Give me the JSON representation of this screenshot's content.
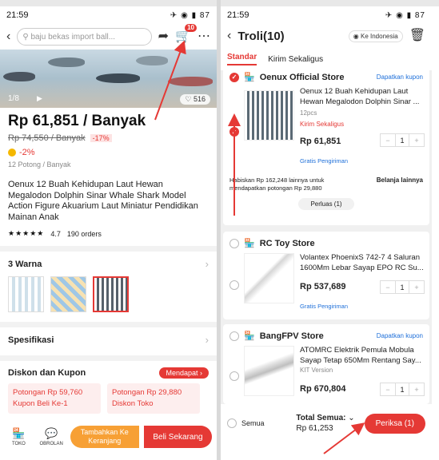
{
  "left": {
    "status": {
      "time": "21:59",
      "right": "87"
    },
    "search": {
      "placeholder": "baju bekas import ball..."
    },
    "cart_badge": "10",
    "gallery": {
      "counter": "1/8",
      "likes": "516"
    },
    "price": "Rp 61,851 / Banyak",
    "old_price": "Rp 74,550 / Banyak",
    "discount_badge": "-17%",
    "coin_discount": "-2%",
    "unit": "12 Potong / Banyak",
    "title": "Oenux 12 Buah Kehidupan Laut Hewan Megalodon Dolphin Sinar Whale Shark Model Action Figure Akuarium Laut Miniatur Pendidikan Mainan Anak",
    "rating": {
      "stars": "★★★★★",
      "value": "4.7",
      "orders": "190 orders"
    },
    "colors_title": "3 Warna",
    "spec_title": "Spesifikasi",
    "coupon_section": {
      "title": "Diskon dan Kupon",
      "badge": "Mendapat"
    },
    "coupons": [
      {
        "line1": "Potongan Rp 59,760",
        "line2": "Kupon Beli Ke-1"
      },
      {
        "line1": "Potongan Rp 29,880",
        "line2": "Diskon Toko"
      }
    ],
    "bottom": {
      "toko": "TOKO",
      "obrolan": "OBROLAN",
      "add_cart": "Tambahkan Ke Keranjang",
      "buy": "Beli Sekarang"
    }
  },
  "right": {
    "status": {
      "time": "21:59",
      "right": "87"
    },
    "header": {
      "title": "Troli(10)",
      "location": "Ke Indonesia"
    },
    "tabs": [
      "Standar",
      "Kirim Sekaligus"
    ],
    "stores": [
      {
        "name": "Oenux Official Store",
        "coupon": "Dapatkan kupon",
        "item": {
          "name": "Oenux 12 Buah Kehidupan Laut Hewan Megalodon Dolphin Sinar ...",
          "variant": "12pcs",
          "tag": "Kirim Sekaligus",
          "price": "Rp 61,851",
          "qty": "1",
          "shipping": "Gratis Pengiriman"
        },
        "promo": {
          "text": "Habiskan Rp 162,248 lainnya untuk mendapatkan potongan Rp 29,880",
          "action": "Belanja lainnya"
        },
        "expand": "Perluas (1)"
      },
      {
        "name": "RC Toy Store",
        "item": {
          "name": "Volantex PhoenixS 742-7 4 Saluran 1600Mm Lebar Sayap EPO RC Su...",
          "price": "Rp 537,689",
          "qty": "1",
          "shipping": "Gratis Pengiriman"
        }
      },
      {
        "name": "BangFPV Store",
        "coupon": "Dapatkan kupon",
        "item": {
          "name": "ATOMRC Elektrik Pemula Mobula Sayap Tetap 650Mm Rentang Say...",
          "variant": "KIT Version",
          "price": "Rp 670,804",
          "qty": "1"
        }
      }
    ],
    "bottom": {
      "select_all": "Semua",
      "total_label": "Total Semua:",
      "total_value": "Rp 61,253",
      "checkout": "Periksa (1)"
    }
  },
  "colors": {
    "accent": "#e53935",
    "orange": "#f7a035",
    "link": "#1e6fd9"
  }
}
